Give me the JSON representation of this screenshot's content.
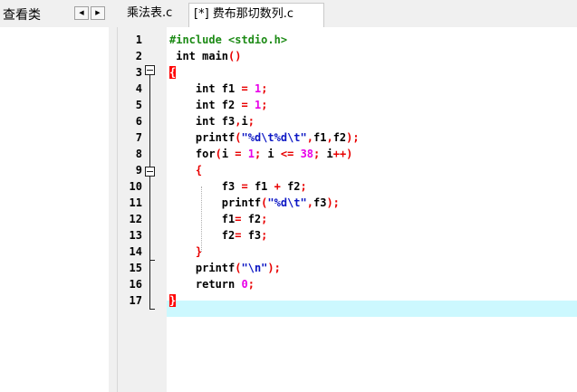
{
  "left_panel": {
    "label": "查看类"
  },
  "nav": {
    "left_arrow": "◀",
    "right_arrow": "▶"
  },
  "tabs": [
    {
      "label": "乘法表.c",
      "active": false
    },
    {
      "label": "[*] 费布那切数列.c",
      "active": true
    }
  ],
  "editor": {
    "current_line": 17,
    "line_numbers": [
      "1",
      "2",
      "3",
      "4",
      "5",
      "6",
      "7",
      "8",
      "9",
      "10",
      "11",
      "12",
      "13",
      "14",
      "15",
      "16",
      "17"
    ],
    "lines": [
      [
        {
          "t": "#include <stdio.h>",
          "c": "pp"
        }
      ],
      [
        {
          "t": " int",
          "c": "kw"
        },
        {
          "t": " main",
          "c": "kw"
        },
        {
          "t": "()",
          "c": "op"
        }
      ],
      [
        {
          "t": "{",
          "c": "br-hl"
        }
      ],
      [
        {
          "t": "    int",
          "c": "kw"
        },
        {
          "t": " f1 ",
          "c": "kw"
        },
        {
          "t": "=",
          "c": "op"
        },
        {
          "t": " ",
          "c": "kw"
        },
        {
          "t": "1",
          "c": "num"
        },
        {
          "t": ";",
          "c": "op"
        }
      ],
      [
        {
          "t": "    int",
          "c": "kw"
        },
        {
          "t": " f2 ",
          "c": "kw"
        },
        {
          "t": "=",
          "c": "op"
        },
        {
          "t": " ",
          "c": "kw"
        },
        {
          "t": "1",
          "c": "num"
        },
        {
          "t": ";",
          "c": "op"
        }
      ],
      [
        {
          "t": "    int",
          "c": "kw"
        },
        {
          "t": " f3",
          "c": "kw"
        },
        {
          "t": ",",
          "c": "op"
        },
        {
          "t": "i",
          "c": "kw"
        },
        {
          "t": ";",
          "c": "op"
        }
      ],
      [
        {
          "t": "    printf",
          "c": "kw"
        },
        {
          "t": "(",
          "c": "op"
        },
        {
          "t": "\"",
          "c": "str"
        },
        {
          "t": "%d",
          "c": "str"
        },
        {
          "t": "\\t",
          "c": "esc"
        },
        {
          "t": "%d",
          "c": "str"
        },
        {
          "t": "\\t",
          "c": "esc"
        },
        {
          "t": "\"",
          "c": "str"
        },
        {
          "t": ",",
          "c": "op"
        },
        {
          "t": "f1",
          "c": "kw"
        },
        {
          "t": ",",
          "c": "op"
        },
        {
          "t": "f2",
          "c": "kw"
        },
        {
          "t": ");",
          "c": "op"
        }
      ],
      [
        {
          "t": "    for",
          "c": "kw"
        },
        {
          "t": "(",
          "c": "op"
        },
        {
          "t": "i ",
          "c": "kw"
        },
        {
          "t": "=",
          "c": "op"
        },
        {
          "t": " ",
          "c": "kw"
        },
        {
          "t": "1",
          "c": "num"
        },
        {
          "t": ";",
          "c": "op"
        },
        {
          "t": " i ",
          "c": "kw"
        },
        {
          "t": "<=",
          "c": "op"
        },
        {
          "t": " ",
          "c": "kw"
        },
        {
          "t": "38",
          "c": "num"
        },
        {
          "t": ";",
          "c": "op"
        },
        {
          "t": " i",
          "c": "kw"
        },
        {
          "t": "++)",
          "c": "op"
        }
      ],
      [
        {
          "t": "    {",
          "c": "br"
        }
      ],
      [
        {
          "t": "        f3 ",
          "c": "kw"
        },
        {
          "t": "=",
          "c": "op"
        },
        {
          "t": " f1 ",
          "c": "kw"
        },
        {
          "t": "+",
          "c": "op"
        },
        {
          "t": " f2",
          "c": "kw"
        },
        {
          "t": ";",
          "c": "op"
        }
      ],
      [
        {
          "t": "        printf",
          "c": "kw"
        },
        {
          "t": "(",
          "c": "op"
        },
        {
          "t": "\"",
          "c": "str"
        },
        {
          "t": "%d",
          "c": "str"
        },
        {
          "t": "\\t",
          "c": "esc"
        },
        {
          "t": "\"",
          "c": "str"
        },
        {
          "t": ",",
          "c": "op"
        },
        {
          "t": "f3",
          "c": "kw"
        },
        {
          "t": ");",
          "c": "op"
        }
      ],
      [
        {
          "t": "        f1",
          "c": "kw"
        },
        {
          "t": "=",
          "c": "op"
        },
        {
          "t": " f2",
          "c": "kw"
        },
        {
          "t": ";",
          "c": "op"
        }
      ],
      [
        {
          "t": "        f2",
          "c": "kw"
        },
        {
          "t": "=",
          "c": "op"
        },
        {
          "t": " f3",
          "c": "kw"
        },
        {
          "t": ";",
          "c": "op"
        }
      ],
      [
        {
          "t": "    }",
          "c": "br"
        }
      ],
      [
        {
          "t": "    printf",
          "c": "kw"
        },
        {
          "t": "(",
          "c": "op"
        },
        {
          "t": "\"",
          "c": "str"
        },
        {
          "t": "\\n",
          "c": "esc"
        },
        {
          "t": "\"",
          "c": "str"
        },
        {
          "t": ");",
          "c": "op"
        }
      ],
      [
        {
          "t": "    return",
          "c": "kw"
        },
        {
          "t": " ",
          "c": "kw"
        },
        {
          "t": "0",
          "c": "num"
        },
        {
          "t": ";",
          "c": "op"
        }
      ],
      [
        {
          "t": "}",
          "c": "br-hl"
        }
      ]
    ]
  },
  "colors": {
    "current_line": "#ccf8fe",
    "keyword": "#000000",
    "preprocessor": "#1d8b16",
    "string": "#0b16c4",
    "number": "#e800e8",
    "operator": "#e80000",
    "brace_match": "#ff0000"
  }
}
